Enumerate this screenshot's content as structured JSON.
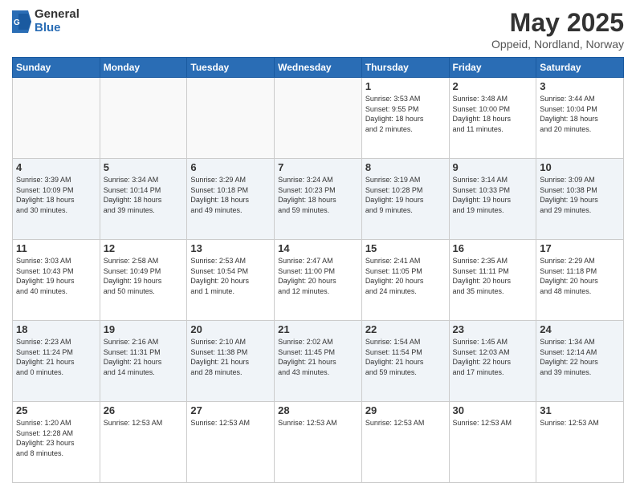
{
  "header": {
    "logo": {
      "general": "General",
      "blue": "Blue"
    },
    "title": "May 2025",
    "location": "Oppeid, Nordland, Norway"
  },
  "calendar": {
    "days_of_week": [
      "Sunday",
      "Monday",
      "Tuesday",
      "Wednesday",
      "Thursday",
      "Friday",
      "Saturday"
    ],
    "weeks": [
      [
        {
          "day": "",
          "info": ""
        },
        {
          "day": "",
          "info": ""
        },
        {
          "day": "",
          "info": ""
        },
        {
          "day": "",
          "info": ""
        },
        {
          "day": "1",
          "info": "Sunrise: 3:53 AM\nSunset: 9:55 PM\nDaylight: 18 hours\nand 2 minutes."
        },
        {
          "day": "2",
          "info": "Sunrise: 3:48 AM\nSunset: 10:00 PM\nDaylight: 18 hours\nand 11 minutes."
        },
        {
          "day": "3",
          "info": "Sunrise: 3:44 AM\nSunset: 10:04 PM\nDaylight: 18 hours\nand 20 minutes."
        }
      ],
      [
        {
          "day": "4",
          "info": "Sunrise: 3:39 AM\nSunset: 10:09 PM\nDaylight: 18 hours\nand 30 minutes."
        },
        {
          "day": "5",
          "info": "Sunrise: 3:34 AM\nSunset: 10:14 PM\nDaylight: 18 hours\nand 39 minutes."
        },
        {
          "day": "6",
          "info": "Sunrise: 3:29 AM\nSunset: 10:18 PM\nDaylight: 18 hours\nand 49 minutes."
        },
        {
          "day": "7",
          "info": "Sunrise: 3:24 AM\nSunset: 10:23 PM\nDaylight: 18 hours\nand 59 minutes."
        },
        {
          "day": "8",
          "info": "Sunrise: 3:19 AM\nSunset: 10:28 PM\nDaylight: 19 hours\nand 9 minutes."
        },
        {
          "day": "9",
          "info": "Sunrise: 3:14 AM\nSunset: 10:33 PM\nDaylight: 19 hours\nand 19 minutes."
        },
        {
          "day": "10",
          "info": "Sunrise: 3:09 AM\nSunset: 10:38 PM\nDaylight: 19 hours\nand 29 minutes."
        }
      ],
      [
        {
          "day": "11",
          "info": "Sunrise: 3:03 AM\nSunset: 10:43 PM\nDaylight: 19 hours\nand 40 minutes."
        },
        {
          "day": "12",
          "info": "Sunrise: 2:58 AM\nSunset: 10:49 PM\nDaylight: 19 hours\nand 50 minutes."
        },
        {
          "day": "13",
          "info": "Sunrise: 2:53 AM\nSunset: 10:54 PM\nDaylight: 20 hours\nand 1 minute."
        },
        {
          "day": "14",
          "info": "Sunrise: 2:47 AM\nSunset: 11:00 PM\nDaylight: 20 hours\nand 12 minutes."
        },
        {
          "day": "15",
          "info": "Sunrise: 2:41 AM\nSunset: 11:05 PM\nDaylight: 20 hours\nand 24 minutes."
        },
        {
          "day": "16",
          "info": "Sunrise: 2:35 AM\nSunset: 11:11 PM\nDaylight: 20 hours\nand 35 minutes."
        },
        {
          "day": "17",
          "info": "Sunrise: 2:29 AM\nSunset: 11:18 PM\nDaylight: 20 hours\nand 48 minutes."
        }
      ],
      [
        {
          "day": "18",
          "info": "Sunrise: 2:23 AM\nSunset: 11:24 PM\nDaylight: 21 hours\nand 0 minutes."
        },
        {
          "day": "19",
          "info": "Sunrise: 2:16 AM\nSunset: 11:31 PM\nDaylight: 21 hours\nand 14 minutes."
        },
        {
          "day": "20",
          "info": "Sunrise: 2:10 AM\nSunset: 11:38 PM\nDaylight: 21 hours\nand 28 minutes."
        },
        {
          "day": "21",
          "info": "Sunrise: 2:02 AM\nSunset: 11:45 PM\nDaylight: 21 hours\nand 43 minutes."
        },
        {
          "day": "22",
          "info": "Sunrise: 1:54 AM\nSunset: 11:54 PM\nDaylight: 21 hours\nand 59 minutes."
        },
        {
          "day": "23",
          "info": "Sunrise: 1:45 AM\nSunset: 12:03 AM\nDaylight: 22 hours\nand 17 minutes."
        },
        {
          "day": "24",
          "info": "Sunrise: 1:34 AM\nSunset: 12:14 AM\nDaylight: 22 hours\nand 39 minutes."
        }
      ],
      [
        {
          "day": "25",
          "info": "Sunrise: 1:20 AM\nSunset: 12:28 AM\nDaylight: 23 hours\nand 8 minutes."
        },
        {
          "day": "26",
          "info": "Sunrise: 12:53 AM"
        },
        {
          "day": "27",
          "info": "Sunrise: 12:53 AM"
        },
        {
          "day": "28",
          "info": "Sunrise: 12:53 AM"
        },
        {
          "day": "29",
          "info": "Sunrise: 12:53 AM"
        },
        {
          "day": "30",
          "info": "Sunrise: 12:53 AM"
        },
        {
          "day": "31",
          "info": "Sunrise: 12:53 AM"
        }
      ]
    ]
  }
}
